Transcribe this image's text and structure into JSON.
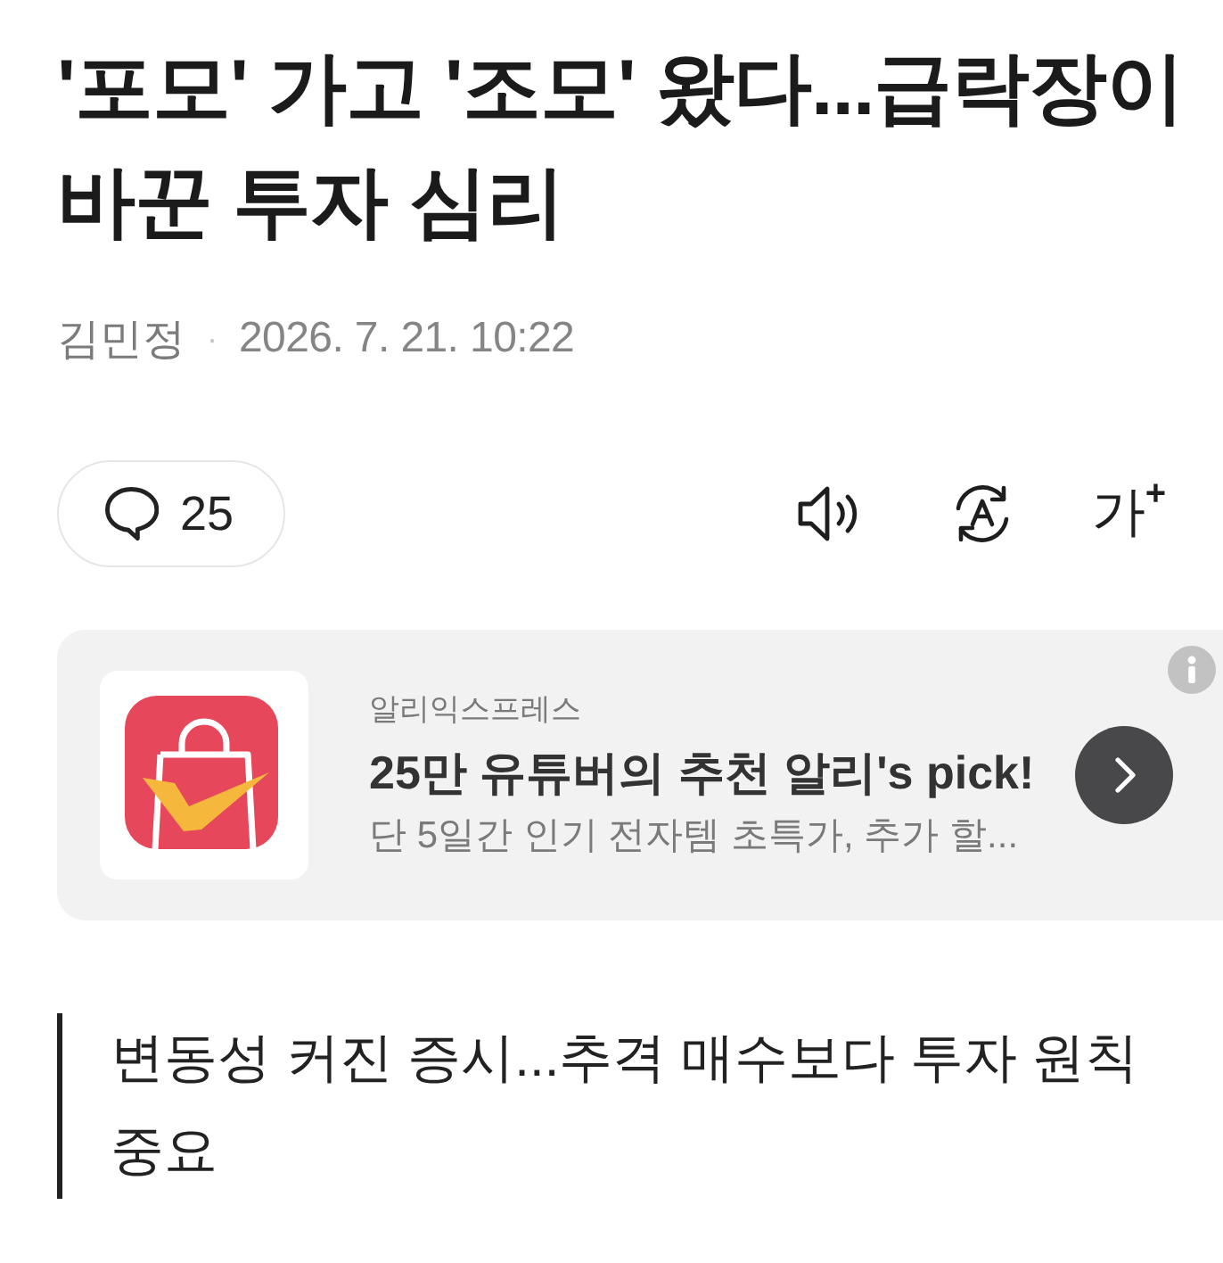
{
  "headline": "'포모' 가고 '조모' 왔다...급락장이 바꾼 투자 심리",
  "byline": {
    "author": "김민정",
    "separator": "·",
    "datetime": "2026. 7. 21. 10:22"
  },
  "toolbar": {
    "comment_count": "25",
    "font_size_button": "가$^{+}$"
  },
  "ad": {
    "advertiser": "알리익스프레스",
    "title": "25만 유튜버의 추천 알리's pick!",
    "description": "단 5일간 인기 전자템 초특가, 추가 할..."
  },
  "subheadline": "변동성 커진 증시...추격 매수보다 투자 원칙 중요"
}
